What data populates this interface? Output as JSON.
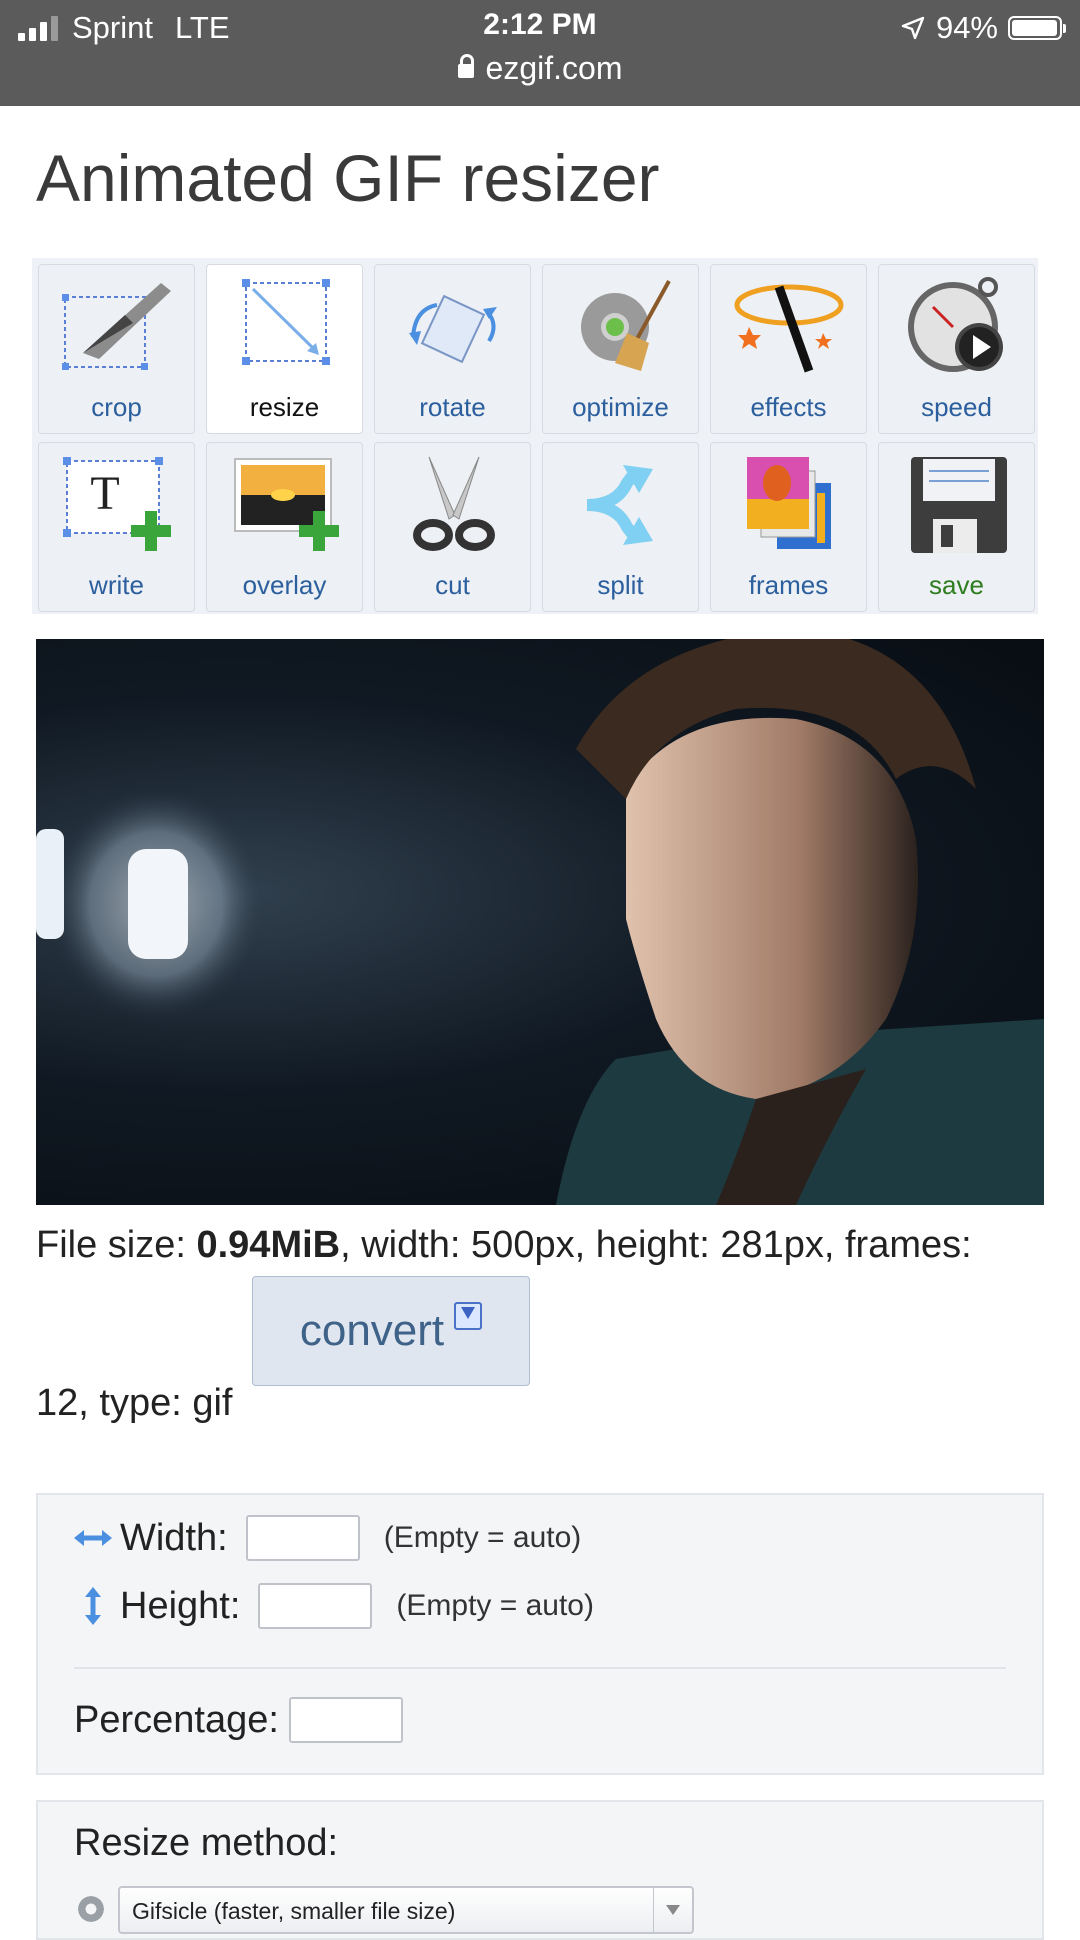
{
  "status": {
    "carrier": "Sprint",
    "network": "LTE",
    "time": "2:12 PM",
    "url": "ezgif.com",
    "battery": "94%"
  },
  "page": {
    "title": "Animated GIF resizer"
  },
  "tools": [
    {
      "label": "crop",
      "icon": "crop-icon"
    },
    {
      "label": "resize",
      "icon": "resize-icon",
      "active": true
    },
    {
      "label": "rotate",
      "icon": "rotate-icon"
    },
    {
      "label": "optimize",
      "icon": "optimize-icon"
    },
    {
      "label": "effects",
      "icon": "effects-icon"
    },
    {
      "label": "speed",
      "icon": "speed-icon"
    },
    {
      "label": "write",
      "icon": "write-icon"
    },
    {
      "label": "overlay",
      "icon": "overlay-icon"
    },
    {
      "label": "cut",
      "icon": "scissors-icon"
    },
    {
      "label": "split",
      "icon": "split-icon"
    },
    {
      "label": "frames",
      "icon": "frames-icon"
    },
    {
      "label": "save",
      "icon": "floppy-disk-icon"
    }
  ],
  "fileinfo": {
    "size_prefix": "File size: ",
    "size_value": "0.94MiB",
    "rest_line1": ", width: 500px, height: 281px, frames:",
    "line2": "12, type: gif"
  },
  "convert": {
    "label": "convert"
  },
  "resize_form": {
    "width_label": "Width:",
    "height_label": "Height:",
    "width_value": "",
    "height_value": "",
    "empty_note": "(Empty = auto)",
    "percentage_label": "Percentage:",
    "percentage_value": ""
  },
  "method": {
    "label": "Resize method:",
    "selected": "Gifsicle (faster, smaller file size)"
  }
}
